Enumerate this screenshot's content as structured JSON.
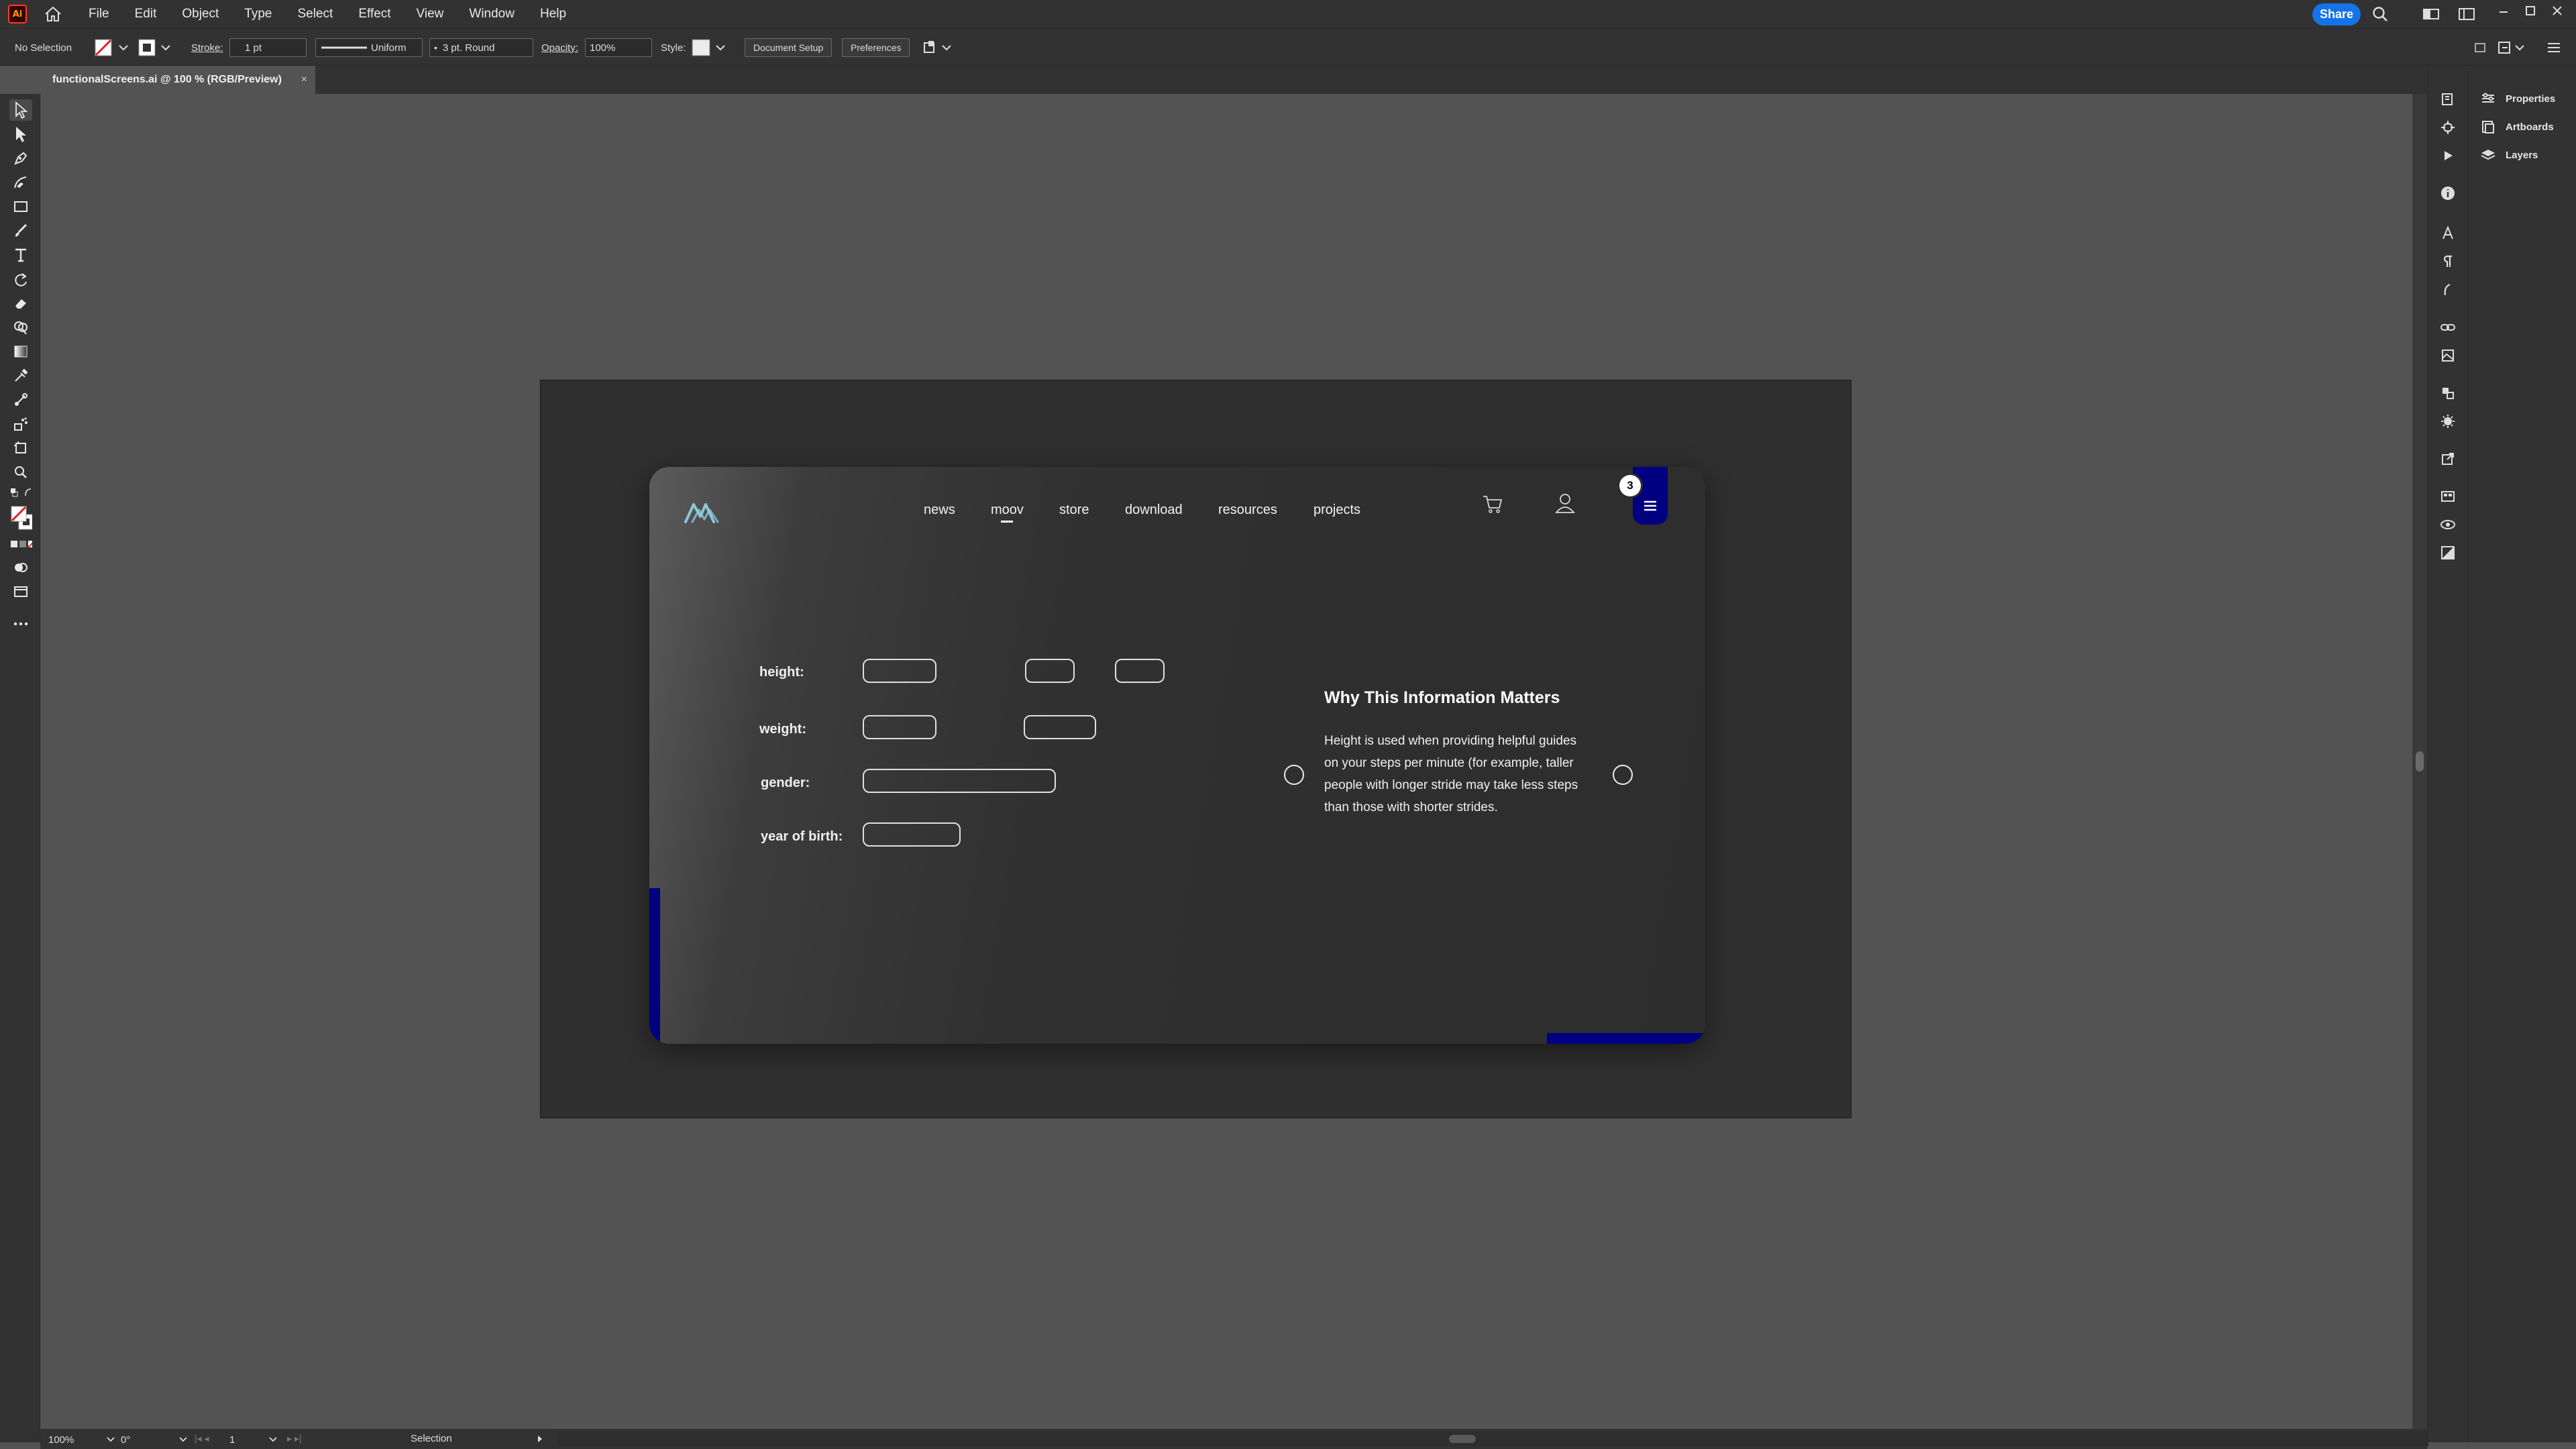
{
  "app": {
    "logo_text": "Ai"
  },
  "menubar": {
    "menus": [
      "File",
      "Edit",
      "Object",
      "Type",
      "Select",
      "Effect",
      "View",
      "Window",
      "Help"
    ],
    "share_label": "Share"
  },
  "controlbar": {
    "selection_label": "No Selection",
    "stroke_label": "Stroke:",
    "stroke_value": "1 pt",
    "profile_value": "Uniform",
    "brush_value": "3 pt. Round",
    "opacity_label": "Opacity:",
    "opacity_value": "100%",
    "style_label": "Style:",
    "document_setup_label": "Document Setup",
    "preferences_label": "Preferences"
  },
  "document_tab": {
    "title": "functionalScreens.ai @ 100 % (RGB/Preview)",
    "close": "×"
  },
  "right_panel": {
    "items": [
      "Properties",
      "Artboards",
      "Layers"
    ]
  },
  "statusbar": {
    "zoom": "100%",
    "rotation": "0°",
    "artboard_number": "1",
    "mode": "Selection"
  },
  "design": {
    "nav": [
      "news",
      "moov",
      "store",
      "download",
      "resources",
      "projects"
    ],
    "active_nav": "moov",
    "notification_count": "3",
    "form_labels": {
      "height": "height:",
      "weight": "weight:",
      "gender": "gender:",
      "year_of_birth": "year of birth:"
    },
    "info_title": "Why This Information Matters",
    "info_lines": [
      "Height is used when providing helpful guides",
      "on your steps per minute (for example, taller",
      "people with longer stride may take less steps",
      "than those with shorter strides."
    ],
    "accent_color": "#000080",
    "logo_color": "#8fc7d8"
  }
}
